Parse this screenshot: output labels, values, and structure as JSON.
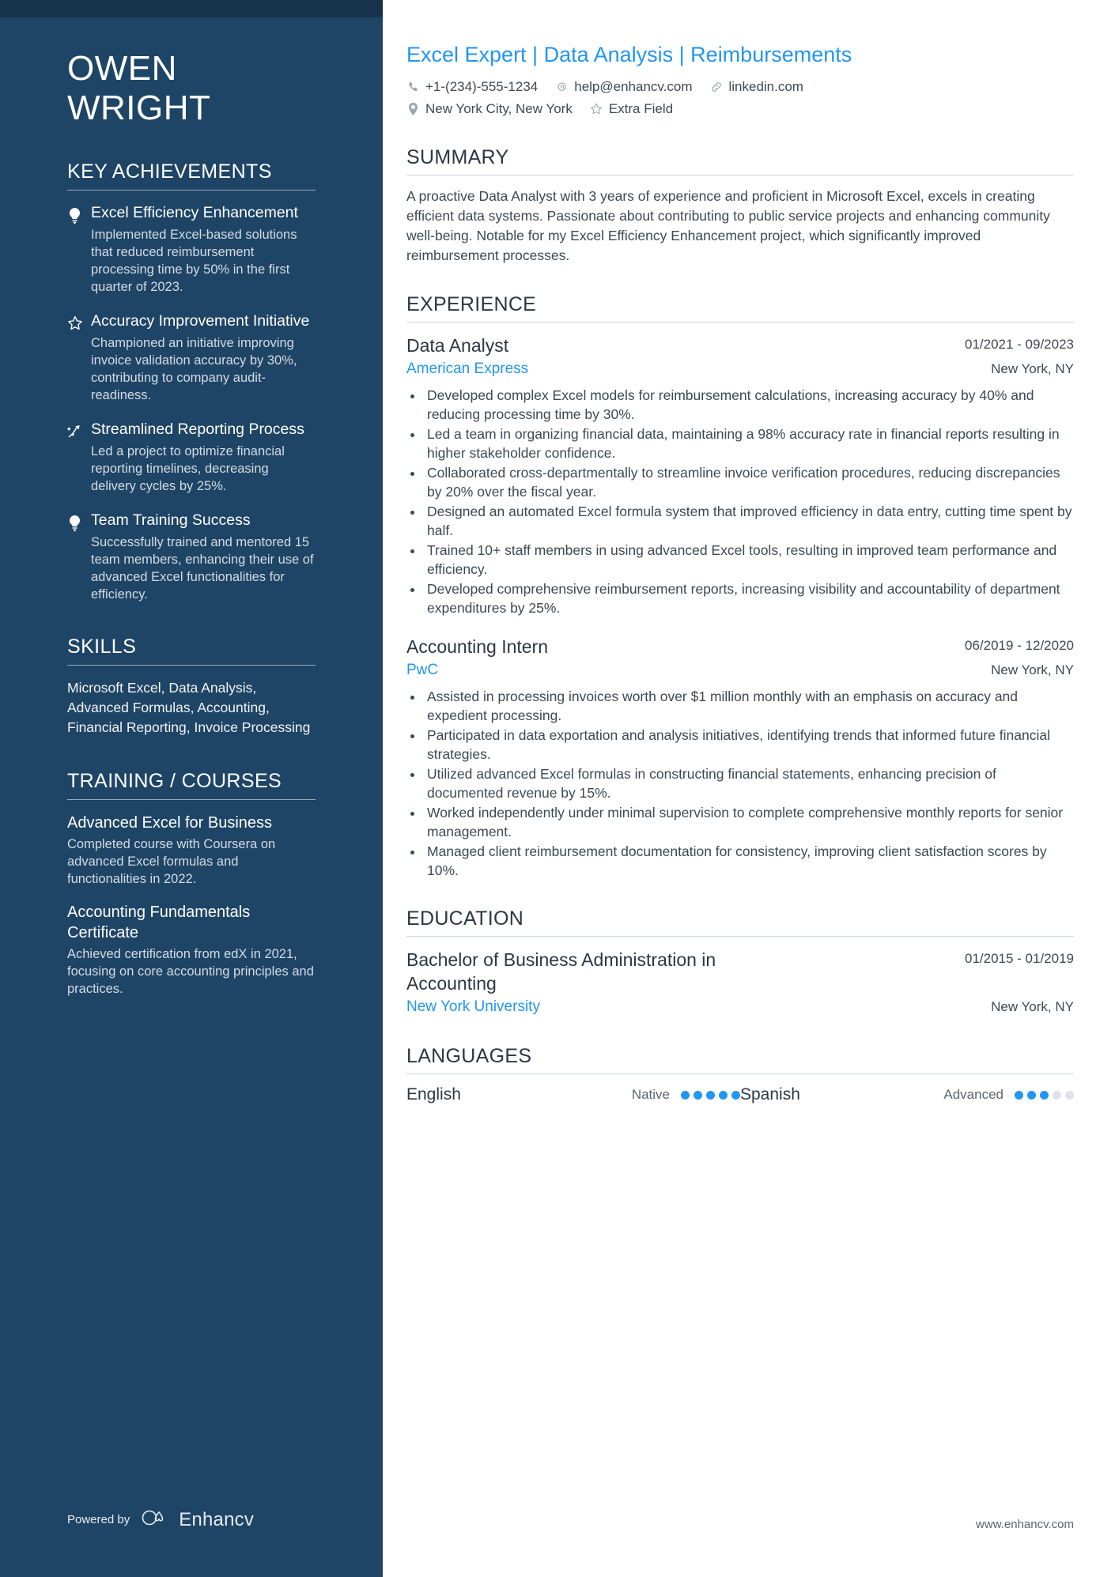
{
  "sidebar": {
    "name_lines": [
      "OWEN",
      "WRIGHT"
    ],
    "achievements": {
      "title": "KEY ACHIEVEMENTS",
      "items": [
        {
          "icon": "lightbulb-icon",
          "title": "Excel Efficiency Enhancement",
          "desc": "Implemented Excel-based solutions that reduced reimbursement processing time by 50% in the first quarter of 2023."
        },
        {
          "icon": "star-icon",
          "title": "Accuracy Improvement Initiative",
          "desc": "Championed an initiative improving invoice validation accuracy by 30%, contributing to company audit-readiness."
        },
        {
          "icon": "trending-arrow-icon",
          "title": "Streamlined Reporting Process",
          "desc": "Led a project to optimize financial reporting timelines, decreasing delivery cycles by 25%."
        },
        {
          "icon": "lightbulb-icon",
          "title": "Team Training Success",
          "desc": "Successfully trained and mentored 15 team members, enhancing their use of advanced Excel functionalities for efficiency."
        }
      ]
    },
    "skills": {
      "title": "SKILLS",
      "text": "Microsoft Excel, Data Analysis, Advanced Formulas, Accounting, Financial Reporting, Invoice Processing"
    },
    "training": {
      "title": "TRAINING / COURSES",
      "items": [
        {
          "title": "Advanced Excel for Business",
          "desc": "Completed course with Coursera on advanced Excel formulas and functionalities in 2022."
        },
        {
          "title": "Accounting Fundamentals Certificate",
          "desc": "Achieved certification from edX in 2021, focusing on core accounting principles and practices."
        }
      ]
    },
    "footer": {
      "powered_by": "Powered by",
      "brand": "Enhancv"
    }
  },
  "main": {
    "headline": "Excel Expert | Data Analysis | Reimbursements",
    "contact": {
      "row1": [
        {
          "icon": "phone-icon",
          "text": "+1-(234)-555-1234"
        },
        {
          "icon": "email-at-icon",
          "text": "help@enhancv.com"
        },
        {
          "icon": "link-icon",
          "text": "linkedin.com"
        }
      ],
      "row2": [
        {
          "icon": "location-pin-icon",
          "text": "New York City, New York"
        },
        {
          "icon": "star-outline-icon",
          "text": "Extra Field"
        }
      ]
    },
    "summary": {
      "title": "SUMMARY",
      "text": "A proactive Data Analyst with 3 years of experience and proficient in Microsoft Excel, excels in creating efficient data systems. Passionate about contributing to public service projects and enhancing community well-being. Notable for my Excel Efficiency Enhancement project, which significantly improved reimbursement processes."
    },
    "experience": {
      "title": "EXPERIENCE",
      "entries": [
        {
          "role": "Data Analyst",
          "date": "01/2021 - 09/2023",
          "company": "American Express",
          "location": "New York, NY",
          "bullets": [
            "Developed complex Excel models for reimbursement calculations, increasing accuracy by 40% and reducing processing time by 30%.",
            "Led a team in organizing financial data, maintaining a 98% accuracy rate in financial reports resulting in higher stakeholder confidence.",
            "Collaborated cross-departmentally to streamline invoice verification procedures, reducing discrepancies by 20% over the fiscal year.",
            "Designed an automated Excel formula system that improved efficiency in data entry, cutting time spent by half.",
            "Trained 10+ staff members in using advanced Excel tools, resulting in improved team performance and efficiency.",
            "Developed comprehensive reimbursement reports, increasing visibility and accountability of department expenditures by 25%."
          ]
        },
        {
          "role": "Accounting Intern",
          "date": "06/2019 - 12/2020",
          "company": "PwC",
          "location": "New York, NY",
          "bullets": [
            "Assisted in processing invoices worth over $1 million monthly with an emphasis on accuracy and expedient processing.",
            "Participated in data exportation and analysis initiatives, identifying trends that informed future financial strategies.",
            "Utilized advanced Excel formulas in constructing financial statements, enhancing precision of documented revenue by 15%.",
            "Worked independently under minimal supervision to complete comprehensive monthly reports for senior management.",
            "Managed client reimbursement documentation for consistency, improving client satisfaction scores by 10%."
          ]
        }
      ]
    },
    "education": {
      "title": "EDUCATION",
      "entries": [
        {
          "degree": "Bachelor of Business Administration in Accounting",
          "date": "01/2015 - 01/2019",
          "school": "New York University",
          "location": "New York, NY"
        }
      ]
    },
    "languages": {
      "title": "LANGUAGES",
      "items": [
        {
          "name": "English",
          "level": "Native",
          "filled": 5,
          "total": 5
        },
        {
          "name": "Spanish",
          "level": "Advanced",
          "filled": 3,
          "total": 5
        }
      ]
    },
    "footer_url": "www.enhancv.com"
  },
  "colors": {
    "sidebar_bg": "#1f4566",
    "sidebar_topbar": "#17334c",
    "accent_blue": "#2196f3",
    "body_text": "#3d4852"
  }
}
